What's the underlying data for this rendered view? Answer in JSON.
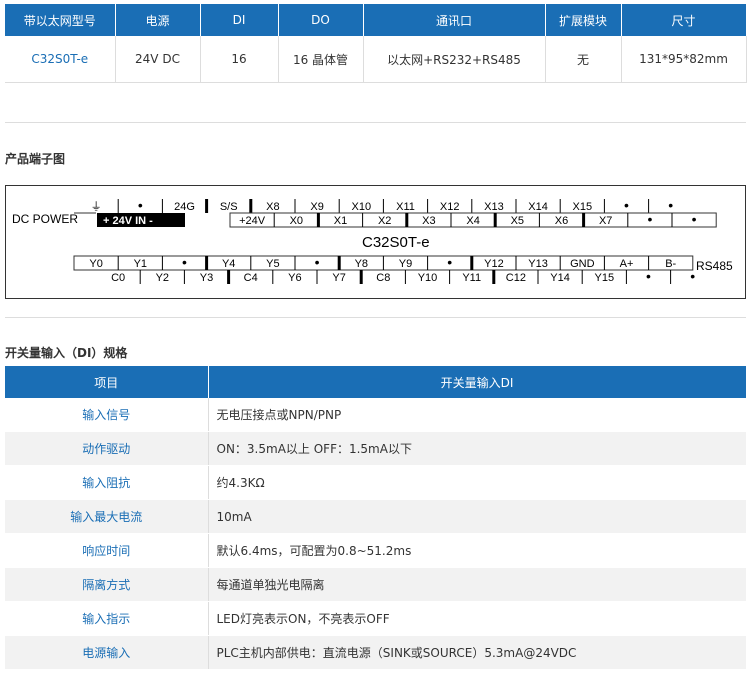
{
  "product_table": {
    "headers": [
      "带以太网型号",
      "电源",
      "DI",
      "DO",
      "通讯口",
      "扩展模块",
      "尺寸"
    ],
    "row": [
      "C32S0T-e",
      "24V DC",
      "16",
      "16 晶体管",
      "以太网+RS232+RS485",
      "无",
      "131*95*82mm"
    ]
  },
  "terminal_section_title": "产品端子图",
  "terminal_diagram": {
    "model": "C32S0T-e",
    "dc_power_label": "DC POWER",
    "power_in_label": "+  24V IN  -",
    "top_row_upper": [
      "⏚",
      "•",
      "24G",
      "S/S",
      "X8",
      "X9",
      "X10",
      "X11",
      "X12",
      "X13",
      "X14",
      "X15",
      "•",
      "•"
    ],
    "top_row_lower": [
      "+24V",
      "X0",
      "X1",
      "X2",
      "X3",
      "X4",
      "X5",
      "X6",
      "X7",
      "•",
      "•"
    ],
    "bottom_row_upper": [
      "Y0",
      "Y1",
      "•",
      "Y4",
      "Y5",
      "•",
      "Y8",
      "Y9",
      "•",
      "Y12",
      "Y13",
      "GND",
      "A+",
      "B-"
    ],
    "rs485_label": "RS485",
    "bottom_row_lower": [
      "C0",
      "Y2",
      "Y3",
      "C4",
      "Y6",
      "Y7",
      "C8",
      "Y10",
      "Y11",
      "C12",
      "Y14",
      "Y15",
      "•",
      "•"
    ]
  },
  "spec_section_title": "开关量输入（DI）规格",
  "spec_table": {
    "headers": [
      "项目",
      "开关量输入DI"
    ],
    "rows": [
      {
        "label": "输入信号",
        "value": "无电压接点或NPN/PNP"
      },
      {
        "label": "动作驱动",
        "value": "ON：3.5mA以上  OFF：1.5mA以下"
      },
      {
        "label": "输入阻抗",
        "value": "约4.3KΩ"
      },
      {
        "label": "输入最大电流",
        "value": "10mA"
      },
      {
        "label": "响应时间",
        "value": "默认6.4ms，可配置为0.8~51.2ms"
      },
      {
        "label": "隔离方式",
        "value": "每通道单独光电隔离"
      },
      {
        "label": "输入指示",
        "value": "LED灯亮表示ON，不亮表示OFF"
      },
      {
        "label": "电源输入",
        "value": "PLC主机内部供电：直流电源（SINK或SOURCE）5.3mA@24VDC"
      }
    ]
  },
  "colors": {
    "accent": "#1a6eb5",
    "row_alt": "#f2f2f2"
  }
}
